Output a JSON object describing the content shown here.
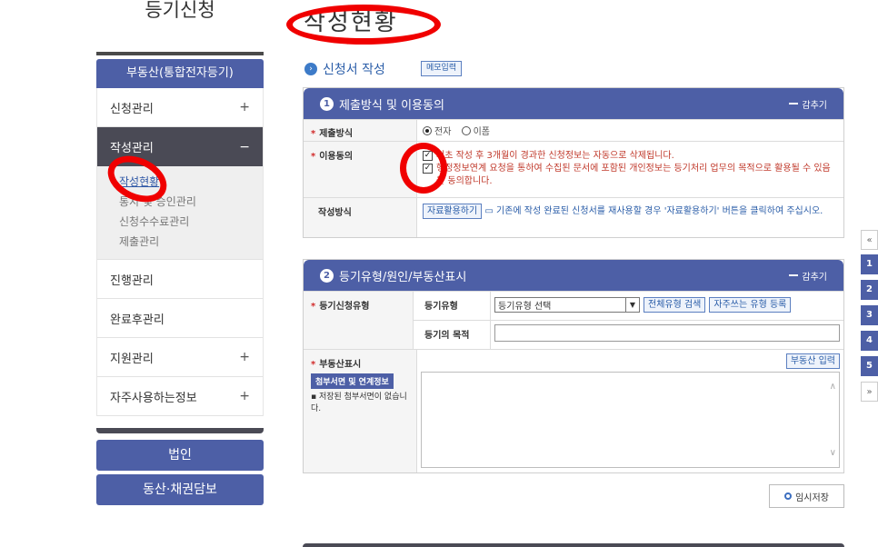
{
  "sidebar": {
    "title": "등기신청",
    "header": "부동산(통합전자등기)",
    "items": [
      {
        "label": "신청관리",
        "toggle": "+"
      },
      {
        "label": "작성관리",
        "toggle": "−"
      },
      {
        "label": "진행관리",
        "toggle": ""
      },
      {
        "label": "완료후관리",
        "toggle": ""
      },
      {
        "label": "지원관리",
        "toggle": "+"
      },
      {
        "label": "자주사용하는정보",
        "toggle": "+"
      }
    ],
    "sub_items": [
      "작성현황",
      "통지 및 승인관리",
      "신청수수료관리",
      "제출관리"
    ],
    "buttons": [
      "법인",
      "동산·채권담보"
    ]
  },
  "main": {
    "title": "작성현황",
    "section_title": "신청서 작성",
    "memo_button": "메모입력",
    "panel1": {
      "title": "제출방식 및 이용동의",
      "number": "1",
      "fold": "감추기",
      "rows": {
        "submit_label": "제출방식",
        "submit_options": [
          "전자",
          "이폼"
        ],
        "agree_label": "이용동의",
        "agree_1": "최초 작성 후 3개월이 경과한 신청정보는 자동으로 삭제됩니다.",
        "agree_2": "행정정보연계 요청을 통하여 수집된 문서에 포함된 개인정보는 등기처리 업무의 목적으로 활용될 수 있음을 동의합니다.",
        "method_label": "작성방식",
        "method_button": "자료활용하기",
        "method_text": "기존에 작성 완료된 신청서를 재사용할 경우 '자료활용하기' 버튼을 클릭하여 주십시오."
      }
    },
    "panel2": {
      "title": "등기유형/원인/부동산표시",
      "number": "2",
      "fold": "감추기",
      "type_label": "등기신청유형",
      "type_sub_label": "등기유형",
      "type_select": "등기유형 선택",
      "search_all_button": "전체유형 검색",
      "frequent_button": "자주쓰는 유형 등록",
      "purpose_label": "등기의 목적",
      "property_label": "부동산표시",
      "property_button": "부동산 입력",
      "attach_button": "첨부서면 및 연계정보",
      "attach_note": "저장된 첨부서면이 없습니다."
    },
    "temp_save": "임시저장"
  },
  "right_nav": [
    "1",
    "2",
    "3",
    "4",
    "5"
  ],
  "colors": {
    "primary": "#4d5fa6",
    "annotation": "#f00000",
    "warning": "#c0392b"
  }
}
